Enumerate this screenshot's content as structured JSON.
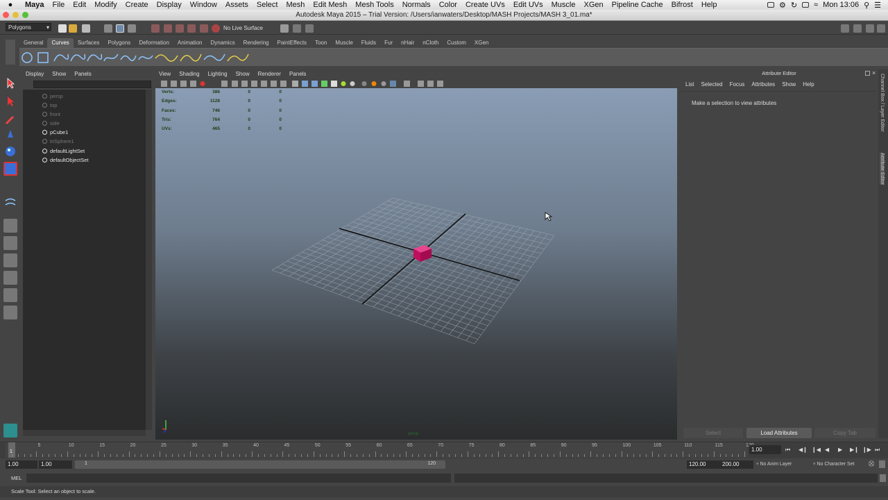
{
  "mac_menu": {
    "app": "Maya",
    "items": [
      "File",
      "Edit",
      "Modify",
      "Create",
      "Display",
      "Window",
      "Assets",
      "Select",
      "Mesh",
      "Edit Mesh",
      "Mesh Tools",
      "Normals",
      "Color",
      "Create UVs",
      "Edit UVs",
      "Muscle",
      "XGen",
      "Pipeline Cache",
      "Bifrost",
      "Help"
    ],
    "clock": "Mon 13:06"
  },
  "window_title": "Autodesk Maya 2015 – Trial Version: /Users/ianwaters/Desktop/MASH Projects/MASH 3_01.ma*",
  "status_line": {
    "mode": "Polygons",
    "live_surface": "No Live Surface"
  },
  "shelf": {
    "tabs": [
      "General",
      "Curves",
      "Surfaces",
      "Polygons",
      "Deformation",
      "Animation",
      "Dynamics",
      "Rendering",
      "PaintEffects",
      "Toon",
      "Muscle",
      "Fluids",
      "Fur",
      "nHair",
      "nCloth",
      "Custom",
      "XGen"
    ],
    "active_tab": "Curves"
  },
  "outliner": {
    "menu": [
      "Display",
      "Show",
      "Panels"
    ],
    "items": [
      {
        "label": "persp",
        "dim": true
      },
      {
        "label": "top",
        "dim": true
      },
      {
        "label": "front",
        "dim": true
      },
      {
        "label": "side",
        "dim": true
      },
      {
        "label": "pCube1",
        "dim": false
      },
      {
        "label": "triSphere1",
        "dim": true
      },
      {
        "label": "defaultLightSet",
        "dim": false
      },
      {
        "label": "defaultObjectSet",
        "dim": false
      }
    ]
  },
  "viewport": {
    "menu": [
      "View",
      "Shading",
      "Lighting",
      "Show",
      "Renderer",
      "Panels"
    ],
    "hud": [
      {
        "label": "Verts:",
        "v1": "386",
        "v2": "0",
        "v3": "0"
      },
      {
        "label": "Edges:",
        "v1": "1128",
        "v2": "0",
        "v3": "0"
      },
      {
        "label": "Faces:",
        "v1": "746",
        "v2": "0",
        "v3": "0"
      },
      {
        "label": "Tris:",
        "v1": "764",
        "v2": "0",
        "v3": "0"
      },
      {
        "label": "UVs:",
        "v1": "465",
        "v2": "0",
        "v3": "0"
      }
    ],
    "camera_label": "persp",
    "object_color": "#d0136a"
  },
  "attribute_editor": {
    "title": "Attribute Editor",
    "menu": [
      "List",
      "Selected",
      "Focus",
      "Attributes",
      "Show",
      "Help"
    ],
    "message": "Make a selection to view attributes",
    "buttons": {
      "select": "Select",
      "load": "Load Attributes",
      "copy": "Copy Tab"
    },
    "side_tabs": {
      "channel": "Channel Box / Layer Editor",
      "attr": "Attribute Editor"
    }
  },
  "timeline": {
    "ticks": [
      "5",
      "10",
      "15",
      "20",
      "25",
      "30",
      "35",
      "40",
      "45",
      "50",
      "55",
      "60",
      "65",
      "70",
      "75",
      "80",
      "85",
      "90",
      "95",
      "100",
      "105",
      "110",
      "115",
      "120"
    ],
    "current_marker": "1",
    "current_frame": "1.00"
  },
  "range": {
    "start": "1.00",
    "playback_start": "1.00",
    "bar_start": "1",
    "bar_end": "120",
    "playback_end": "120.00",
    "end": "200.00",
    "anim_layer": "No Anim Layer",
    "character_set": "No Character Set"
  },
  "command_line": {
    "label": "MEL"
  },
  "help_line": "Scale Tool: Select an object to scale."
}
